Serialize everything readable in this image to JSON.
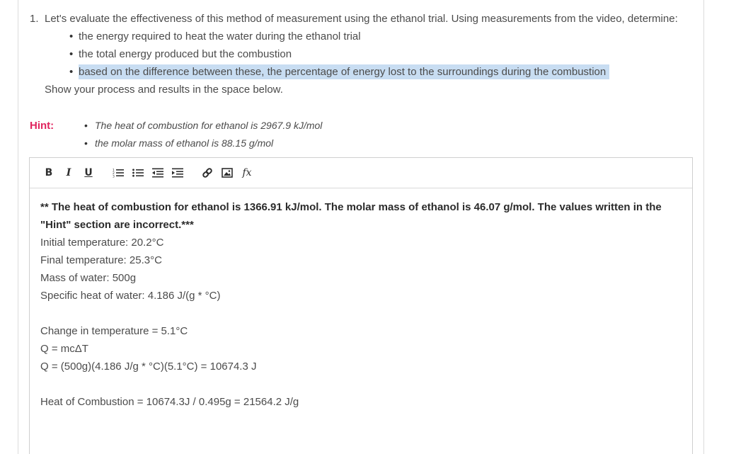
{
  "question": {
    "number": "1.",
    "intro": "Let's evaluate the effectiveness of this method of measurement using the ethanol trial. Using measurements from the video, determine:",
    "bullets": [
      "the energy required to heat the water during the ethanol trial",
      "the total energy produced but the combustion",
      "based on the difference between these, the percentage of energy lost to the surroundings during the combustion"
    ],
    "instruction": "Show your process and results in the space below."
  },
  "hint": {
    "label": "Hint:",
    "items": [
      "The heat of combustion for ethanol is 2967.9 kJ/mol",
      "the molar mass of ethanol is 88.15 g/mol"
    ]
  },
  "toolbar": {
    "bold": "B",
    "italic": "I",
    "underline": "U",
    "formula": "fx"
  },
  "answer": {
    "note": "** The heat of combustion for ethanol is 1366.91 kJ/mol. The molar mass of ethanol is 46.07 g/mol. The values written in the \"Hint\" section are incorrect.***",
    "measurements": [
      "Initial temperature: 20.2°C",
      "Final temperature: 25.3°C",
      "Mass of water: 500g",
      "Specific heat of water: 4.186 J/(g * °C)"
    ],
    "calculations": [
      "Change in temperature = 5.1°C",
      "Q = mcΔT",
      "Q = (500g)(4.186 J/g * °C)(5.1°C) = 10674.3 J"
    ],
    "combustion": "Heat of Combustion = 10674.3J / 0.495g = 21564.2 J/g"
  },
  "colors": {
    "hint_label": "#e0245e",
    "selection_highlight": "#c8ddf2"
  }
}
